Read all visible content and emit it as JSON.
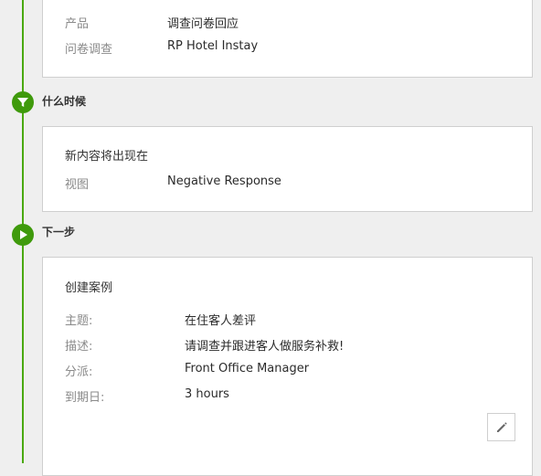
{
  "card_top": {
    "rows": [
      {
        "label": "产品",
        "value": "调查问卷回应"
      },
      {
        "label": "问卷调查",
        "value": "RP Hotel Instay"
      }
    ]
  },
  "when": {
    "label": "什么时候",
    "icon": "filter-icon",
    "card_title": "新内容将出现在",
    "rows": [
      {
        "label": "视图",
        "value": "Negative Response"
      }
    ]
  },
  "next": {
    "label": "下一步",
    "icon": "play-icon",
    "card_title": "创建案例",
    "rows": [
      {
        "label": "主题:",
        "value": "在住客人差评"
      },
      {
        "label": "描述:",
        "value": "请调查并跟进客人做服务补救!"
      },
      {
        "label": "分派:",
        "value": "Front Office Manager"
      },
      {
        "label": "到期日:",
        "value": "3 hours"
      }
    ],
    "edit_icon": "pencil-icon"
  },
  "colors": {
    "accent": "#3f9a0c",
    "timeline": "#4aa90f"
  }
}
